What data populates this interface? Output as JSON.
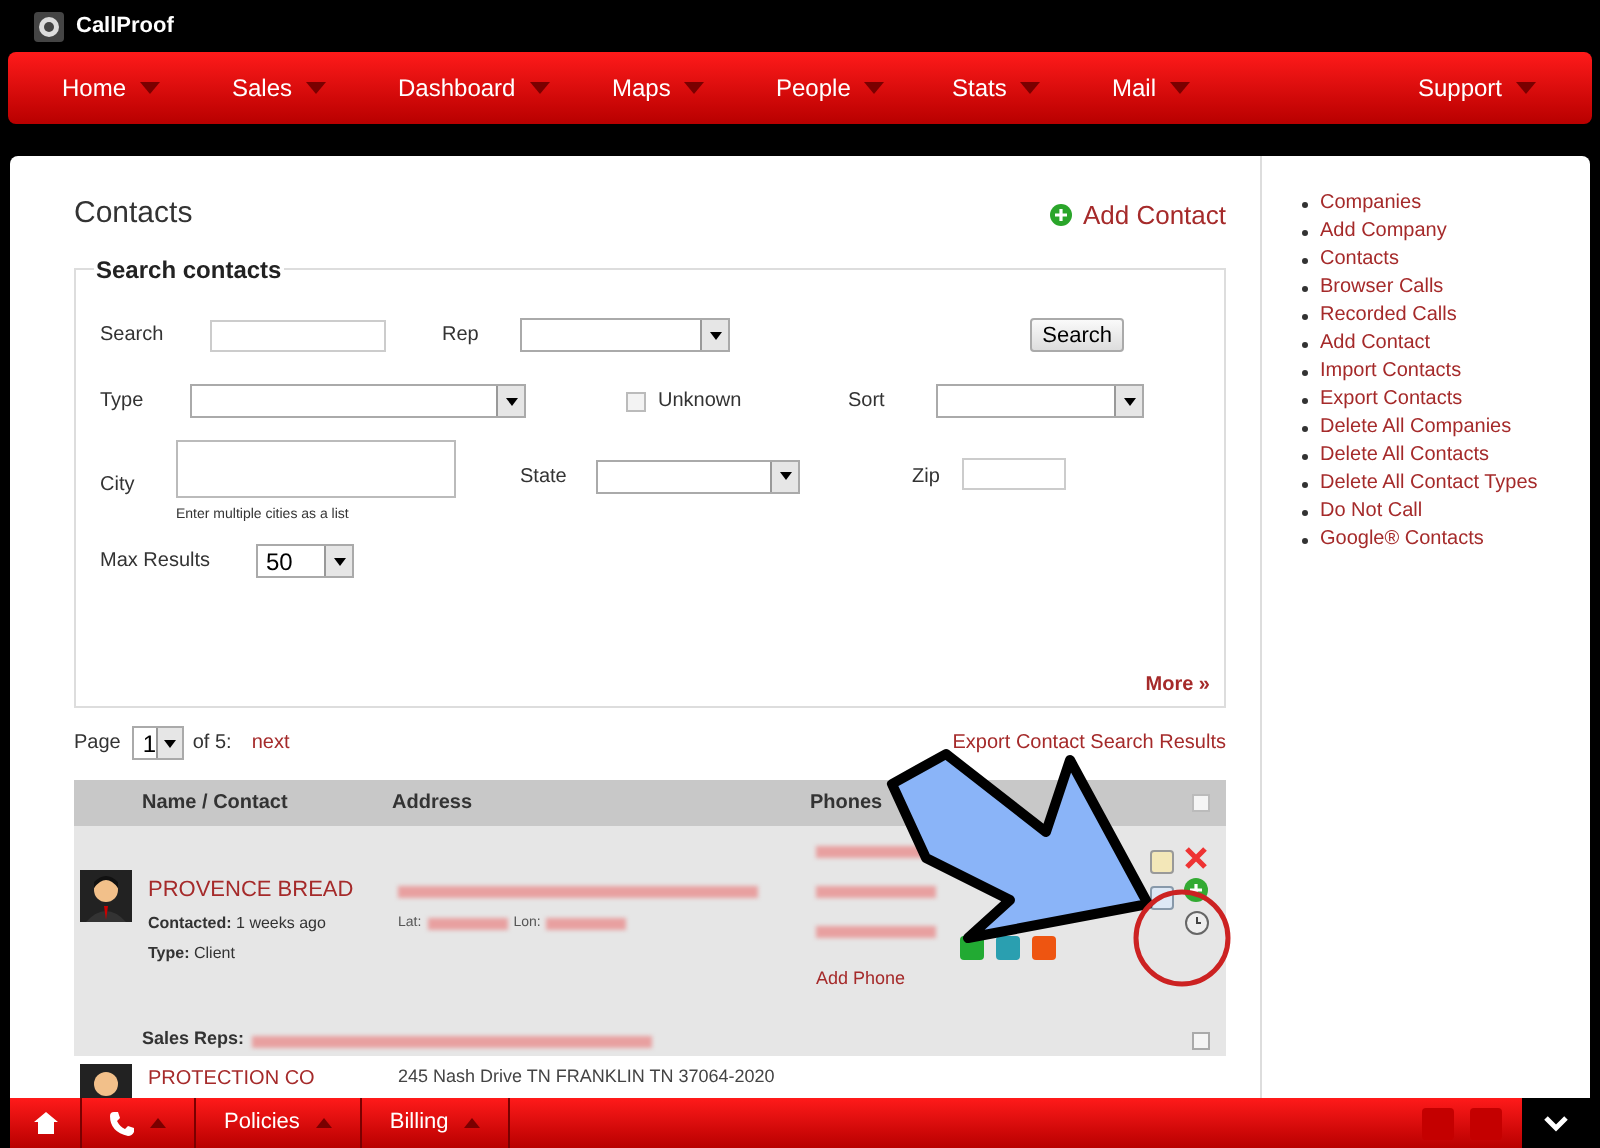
{
  "app": {
    "name": "CallProof"
  },
  "nav": [
    {
      "label": "Home"
    },
    {
      "label": "Sales"
    },
    {
      "label": "Dashboard"
    },
    {
      "label": "Maps"
    },
    {
      "label": "People"
    },
    {
      "label": "Stats"
    },
    {
      "label": "Mail"
    },
    {
      "label": "Support"
    }
  ],
  "page": {
    "title": "Contacts",
    "add_link": "Add Contact"
  },
  "search": {
    "legend": "Search contacts",
    "labels": {
      "search": "Search",
      "rep": "Rep",
      "type": "Type",
      "unknown": "Unknown",
      "sort": "Sort",
      "city": "City",
      "state": "State",
      "zip": "Zip",
      "max": "Max Results"
    },
    "unknown_checked": false,
    "city_hint": "Enter multiple cities as a list",
    "max_value": "50",
    "button": "Search",
    "more": "More »"
  },
  "pager": {
    "label": "Page",
    "value": "1",
    "of": "of 5:",
    "next": "next",
    "export": "Export Contact Search Results"
  },
  "table": {
    "columns": [
      "Name / Contact",
      "Address",
      "Phones"
    ],
    "select_all_checked": false,
    "rows": [
      {
        "name": "PROVENCE BREAD",
        "contacted_label": "Contacted:",
        "contacted": "1 weeks ago",
        "type_label": "Type:",
        "type": "Client",
        "lat_label": "Lat:",
        "lon_label": "Lon:",
        "add_phone": "Add Phone",
        "reps_label": "Sales Reps:",
        "checked": false
      },
      {
        "name": "PROTECTION CO",
        "address": "245 Nash Drive TN FRANKLIN TN 37064-2020"
      }
    ]
  },
  "sidebar": {
    "links": [
      "Companies",
      "Add Company",
      "Contacts",
      "Browser Calls",
      "Recorded Calls",
      "Add Contact",
      "Import Contacts",
      "Export Contacts",
      "Delete All Companies",
      "Delete All Contacts",
      "Delete All Contact Types",
      "Do Not Call",
      "Google® Contacts"
    ]
  },
  "footer": {
    "items": [
      {
        "kind": "home"
      },
      {
        "kind": "phone"
      },
      {
        "kind": "text",
        "label": "Policies"
      },
      {
        "kind": "text",
        "label": "Billing"
      }
    ]
  }
}
